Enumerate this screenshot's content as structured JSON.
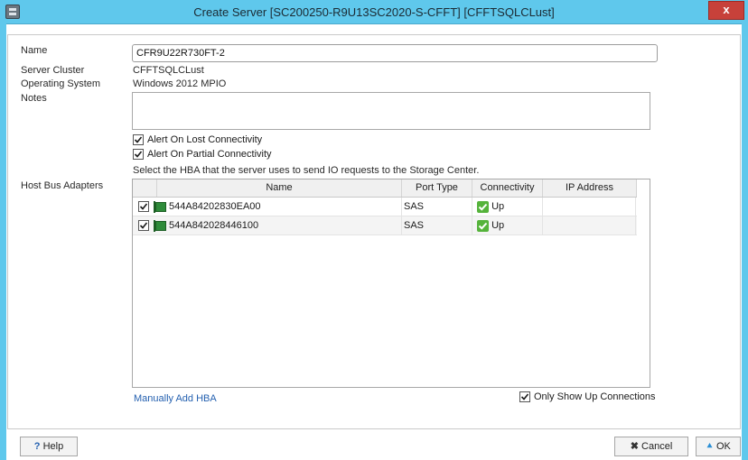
{
  "window": {
    "title": "Create Server [SC200250-R9U13SC2020-S-CFFT] [CFFTSQLCLust]",
    "close_label": "x"
  },
  "form": {
    "name_label": "Name",
    "name_value": "CFR9U22R730FT-2",
    "cluster_label": "Server Cluster",
    "cluster_value": "CFFTSQLCLust",
    "os_label": "Operating System",
    "os_value": "Windows 2012 MPIO",
    "notes_label": "Notes",
    "notes_value": "",
    "alert_lost_label": "Alert On Lost Connectivity",
    "alert_lost_checked": true,
    "alert_partial_label": "Alert On Partial Connectivity",
    "alert_partial_checked": true,
    "hba_instruction": "Select the HBA that the server uses to send IO requests to the Storage Center.",
    "hba_label": "Host Bus Adapters"
  },
  "hba_table": {
    "columns": [
      "Name",
      "Port Type",
      "Connectivity",
      "IP Address"
    ],
    "rows": [
      {
        "checked": true,
        "name": "544A84202830EA00",
        "port_type": "SAS",
        "connectivity": "Up",
        "ip": ""
      },
      {
        "checked": true,
        "name": "544A842028446100",
        "port_type": "SAS",
        "connectivity": "Up",
        "ip": ""
      }
    ]
  },
  "footer": {
    "manual_add_link": "Manually Add HBA",
    "only_show_up_label": "Only Show Up Connections",
    "only_show_up_checked": true
  },
  "buttons": {
    "help": "Help",
    "help_icon": "?",
    "cancel": "Cancel",
    "ok": "OK"
  },
  "colors": {
    "titlebar": "#5fc8ec",
    "close": "#c7413a",
    "link": "#2561b0",
    "status_up": "#55b33b"
  }
}
